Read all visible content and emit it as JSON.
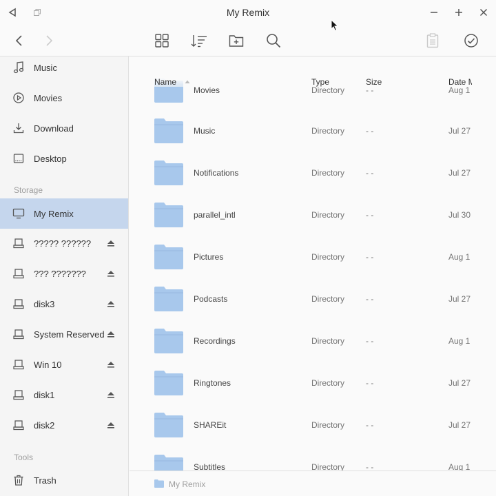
{
  "window": {
    "title": "My Remix",
    "back_icon": "triangle-back-icon",
    "restore_icon": "restore-icon",
    "minimize_icon": "minimize-icon",
    "maximize_icon": "plus-icon",
    "close_icon": "close-icon"
  },
  "toolbar": {
    "items": [
      "nav-back-icon",
      "nav-forward-icon",
      "grid-view-icon",
      "sort-icon",
      "new-folder-icon",
      "search-icon",
      "clipboard-icon",
      "select-check-icon"
    ]
  },
  "sidebar": {
    "places": [
      {
        "label": "Music",
        "icon": "music-icon"
      },
      {
        "label": "Movies",
        "icon": "play-circle-icon"
      },
      {
        "label": "Download",
        "icon": "download-icon"
      },
      {
        "label": "Desktop",
        "icon": "desktop-icon"
      }
    ],
    "storage_heading": "Storage",
    "storage": [
      {
        "label": "My Remix",
        "icon": "monitor-icon",
        "active": true,
        "eject": false
      },
      {
        "label": "????? ??????",
        "icon": "drive-icon",
        "eject": true
      },
      {
        "label": "??? ???????",
        "icon": "drive-icon",
        "eject": true
      },
      {
        "label": "disk3",
        "icon": "drive-icon",
        "eject": true
      },
      {
        "label": "System Reserved",
        "icon": "drive-icon",
        "eject": true
      },
      {
        "label": "Win 10",
        "icon": "drive-icon",
        "eject": true
      },
      {
        "label": "disk1",
        "icon": "drive-icon",
        "eject": true
      },
      {
        "label": "disk2",
        "icon": "drive-icon",
        "eject": true
      }
    ],
    "tools_heading": "Tools",
    "tools": [
      {
        "label": "Trash",
        "icon": "trash-icon"
      }
    ]
  },
  "files": {
    "columns": {
      "name": "Name",
      "type": "Type",
      "size": "Size",
      "date": "Date M"
    },
    "rows": [
      {
        "name": "Movies",
        "type": "Directory",
        "size": "- -",
        "date": "Aug 1"
      },
      {
        "name": "Music",
        "type": "Directory",
        "size": "- -",
        "date": "Jul 27"
      },
      {
        "name": "Notifications",
        "type": "Directory",
        "size": "- -",
        "date": "Jul 27"
      },
      {
        "name": "parallel_intl",
        "type": "Directory",
        "size": "- -",
        "date": "Jul 30"
      },
      {
        "name": "Pictures",
        "type": "Directory",
        "size": "- -",
        "date": "Aug 1"
      },
      {
        "name": "Podcasts",
        "type": "Directory",
        "size": "- -",
        "date": "Jul 27"
      },
      {
        "name": "Recordings",
        "type": "Directory",
        "size": "- -",
        "date": "Aug 1"
      },
      {
        "name": "Ringtones",
        "type": "Directory",
        "size": "- -",
        "date": "Jul 27"
      },
      {
        "name": "SHAREit",
        "type": "Directory",
        "size": "- -",
        "date": "Jul 27"
      },
      {
        "name": "Subtitles",
        "type": "Directory",
        "size": "- -",
        "date": "Aug 1"
      }
    ]
  },
  "statusbar": {
    "path": "My Remix"
  },
  "colors": {
    "accent": "#c5d6ed",
    "folder": "#a8c8ec"
  }
}
